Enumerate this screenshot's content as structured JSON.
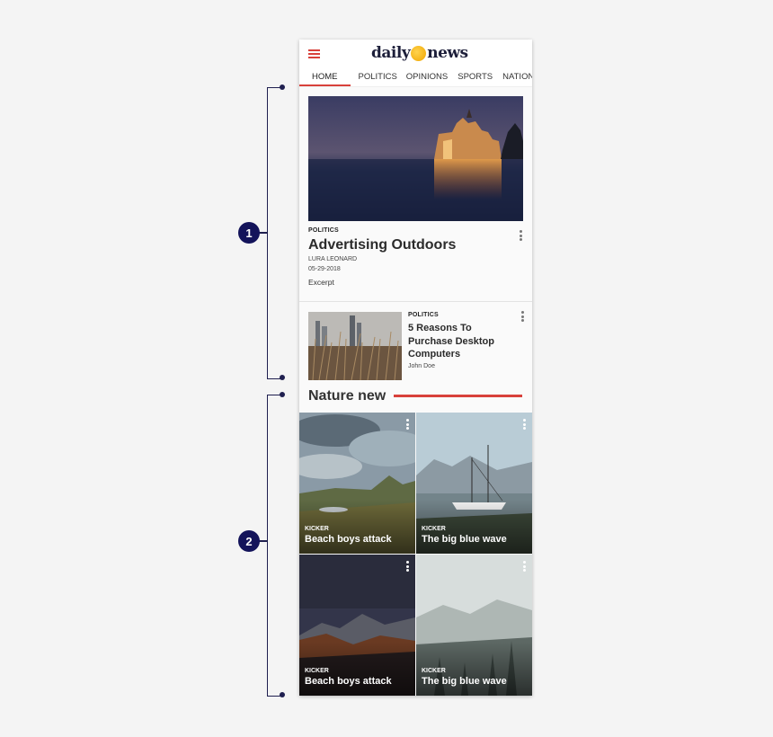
{
  "annotations": [
    "1",
    "2"
  ],
  "app": {
    "logo_left": "daily",
    "logo_right": "news"
  },
  "nav": {
    "tabs": [
      "HOME",
      "POLITICS",
      "OPINIONS",
      "SPORTS",
      "NATION"
    ],
    "active": "HOME"
  },
  "featured": {
    "kicker": "POLITICS",
    "title": "Advertising Outdoors",
    "author": "LURA LEONARD",
    "date": "05-29-2018",
    "excerpt": "Excerpt"
  },
  "secondary": {
    "kicker": "POLITICS",
    "title": "5 Reasons To Purchase Desktop Computers",
    "author": "John Doe"
  },
  "section": {
    "title": "Nature new",
    "tiles": [
      {
        "kicker": "KICKER",
        "title": "Beach boys attack"
      },
      {
        "kicker": "KICKER",
        "title": "The big blue wave"
      },
      {
        "kicker": "KICKER",
        "title": "Beach boys attack"
      },
      {
        "kicker": "KICKER",
        "title": "The big blue wave"
      }
    ]
  },
  "colors": {
    "accent": "#d8413b",
    "badge": "#13135a",
    "logo": "#1d1f3a"
  }
}
